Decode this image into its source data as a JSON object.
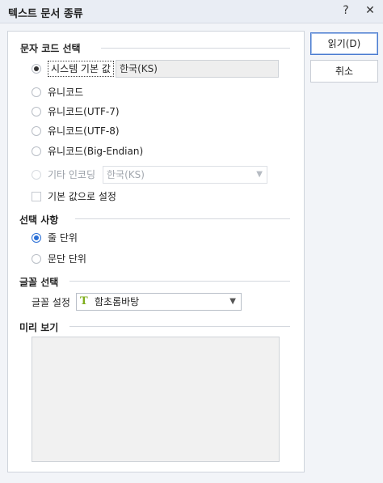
{
  "window": {
    "title": "텍스트 문서 종류",
    "help_label": "?",
    "close_label": "✕"
  },
  "encoding_section": {
    "title": "문자 코드 선택",
    "options": [
      {
        "label": "시스템 기본 값",
        "selected": true
      },
      {
        "label": "유니코드",
        "selected": false
      },
      {
        "label": "유니코드(UTF-7)",
        "selected": false
      },
      {
        "label": "유니코드(UTF-8)",
        "selected": false
      },
      {
        "label": "유니코드(Big-Endian)",
        "selected": false
      },
      {
        "label": "기타 인코딩",
        "selected": false,
        "disabled": true
      }
    ],
    "system_default_value": "한국(KS)",
    "other_encoding_value": "한국(KS)",
    "set_default_label": "기본 값으로 설정",
    "set_default_checked": false
  },
  "options_section": {
    "title": "선택 사항",
    "options": [
      {
        "label": "줄 단위",
        "selected": true
      },
      {
        "label": "문단 단위",
        "selected": false
      }
    ]
  },
  "font_section": {
    "title": "글꼴 선택",
    "font_setting_label": "글꼴 설정",
    "font_value": "함초롬바탕",
    "font_icon": "font-type-icon"
  },
  "preview_section": {
    "title": "미리 보기"
  },
  "buttons": {
    "read_label": "읽기(D)",
    "cancel_label": "취소"
  },
  "colors": {
    "accent": "#2a6fd6",
    "font_icon": "#7fae1e"
  }
}
